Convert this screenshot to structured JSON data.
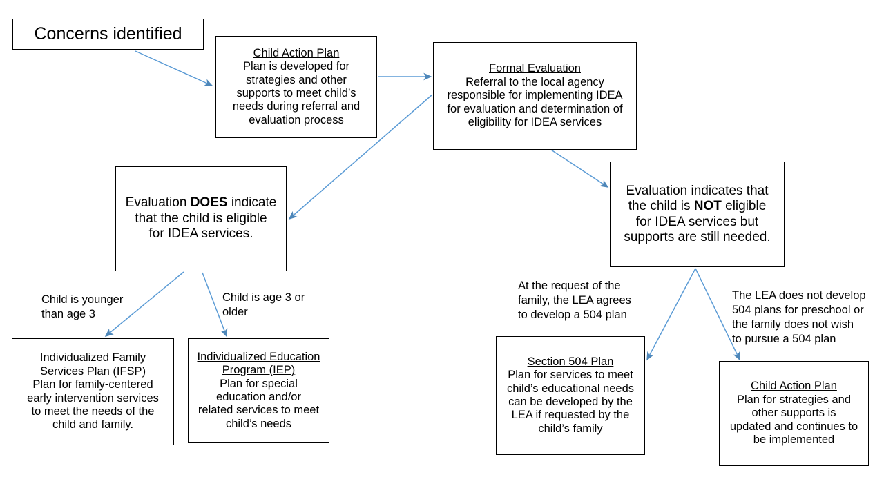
{
  "diagram": {
    "title": "IDEA referral and evaluation flowchart",
    "accent_color": "#4E87B9",
    "border_color": "#000000",
    "text_color": "#000000",
    "background_color": "#FFFFFF"
  },
  "nodes": {
    "concerns": {
      "title": "",
      "body": "Concerns identified"
    },
    "child_action_plan_top": {
      "title": "Child Action Plan",
      "body": "Plan is developed for\nstrategies and other\nsupports to meet child’s\nneeds during referral and\nevaluation process"
    },
    "formal_evaluation": {
      "title": "Formal Evaluation",
      "body": "Referral to the local agency\nresponsible for implementing IDEA\nfor evaluation and determination of\neligibility  for IDEA services"
    },
    "eligible": {
      "line1_a": "Evaluation ",
      "line1_b": "DOES",
      "line1_c": " indicate",
      "line2": "that the child is eligible",
      "line3": "for IDEA services."
    },
    "not_eligible": {
      "line1": "Evaluation indicates that",
      "line2_a": "the child is ",
      "line2_b": "NOT",
      "line2_c": " eligible",
      "line3": "for IDEA services  but",
      "line4": "supports are still needed."
    },
    "ifsp": {
      "title_line1": "Individualized Family",
      "title_line2": "Services Plan (IFSP)",
      "body": "Plan for family-centered\nearly intervention services\nto meet the needs of the\nchild and family."
    },
    "iep": {
      "title_line1": "Individualized Education",
      "title_line2": "Program (IEP)",
      "body": "Plan for special\neducation and/or\nrelated services to meet\nchild’s needs"
    },
    "section_504": {
      "title": "Section 504 Plan",
      "body": "Plan for services to meet\nchild’s educational needs\ncan be developed by the\nLEA if requested by the\nchild’s family"
    },
    "child_action_plan_bottom": {
      "title": "Child Action Plan",
      "body": "Plan for strategies and\nother supports is\nupdated and continues to\nbe implemented"
    }
  },
  "edge_labels": {
    "younger_than_3": "Child is younger\nthan age 3",
    "age_3_or_older": "Child is age 3 or\nolder",
    "family_request_504": "At the request of the\nfamily, the LEA agrees\nto develop a 504 plan",
    "no_504_plan": "The LEA does not develop\n504 plans for preschool or\nthe family does not wish\nto pursue a 504 plan"
  },
  "edges": [
    {
      "name": "concerns-to-child-action-plan",
      "from": "concerns",
      "to": "child_action_plan_top",
      "label": ""
    },
    {
      "name": "child-action-plan-to-formal-evaluation",
      "from": "child_action_plan_top",
      "to": "formal_evaluation",
      "label": ""
    },
    {
      "name": "formal-evaluation-to-eligible",
      "from": "formal_evaluation",
      "to": "eligible",
      "label": ""
    },
    {
      "name": "formal-evaluation-to-not-eligible",
      "from": "formal_evaluation",
      "to": "not_eligible",
      "label": ""
    },
    {
      "name": "eligible-to-ifsp",
      "from": "eligible",
      "to": "ifsp",
      "label": "Child is younger than age 3"
    },
    {
      "name": "eligible-to-iep",
      "from": "eligible",
      "to": "iep",
      "label": "Child is age 3 or older"
    },
    {
      "name": "not-eligible-to-section-504",
      "from": "not_eligible",
      "to": "section_504",
      "label": "At the request of the family, the LEA agrees to develop a 504 plan"
    },
    {
      "name": "not-eligible-to-child-action-plan",
      "from": "not_eligible",
      "to": "child_action_plan_bottom",
      "label": "The LEA does not develop 504 plans for preschool or the family does not wish to pursue a 504 plan"
    }
  ]
}
